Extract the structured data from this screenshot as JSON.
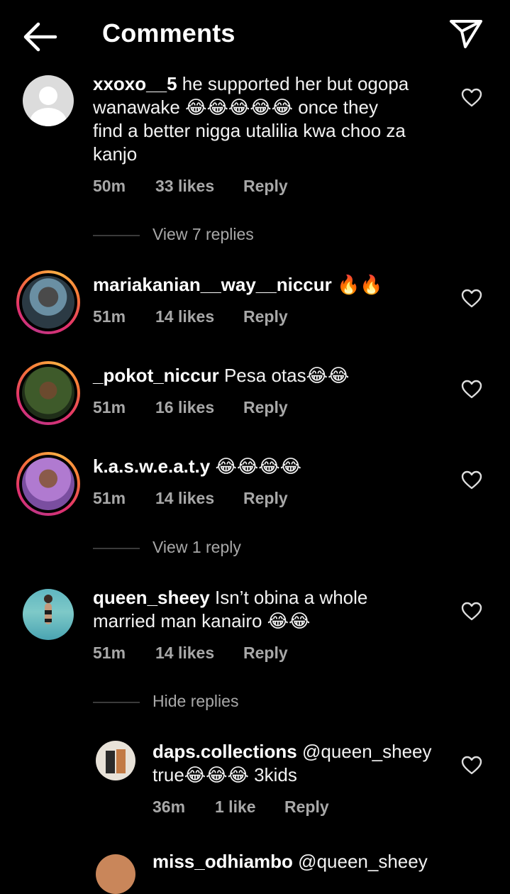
{
  "header": {
    "title": "Comments",
    "back_icon": "arrow-left-icon",
    "share_icon": "paper-plane-icon"
  },
  "comments": [
    {
      "username": "xxoxo__5",
      "text_a": "he supported her but ogopa",
      "text_b": "wanawake 😂😂😂😂😂 once they",
      "text_c": "find a better nigga utalilia kwa choo za",
      "text_d": "kanjo",
      "time": "50m",
      "likes": "33 likes",
      "reply": "Reply",
      "thread": "View 7 replies"
    },
    {
      "username": "mariakanian__way__niccur",
      "text": "🔥🔥",
      "time": "51m",
      "likes": "14 likes",
      "reply": "Reply"
    },
    {
      "username": "_pokot_niccur",
      "text": "Pesa otas😂😂",
      "time": "51m",
      "likes": "16 likes",
      "reply": "Reply"
    },
    {
      "username": "k.a.s.w.e.a.t.y",
      "text": "😂😂😂😂",
      "time": "51m",
      "likes": "14 likes",
      "reply": "Reply",
      "thread": "View 1 reply"
    },
    {
      "username": "queen_sheey",
      "text_a": "Isn’t obina a whole",
      "text_b": "married man kanairo 😂😂",
      "time": "51m",
      "likes": "14 likes",
      "reply": "Reply",
      "thread": "Hide replies"
    }
  ],
  "replies": [
    {
      "username": "daps.collections",
      "text_a": "@queen_sheey",
      "text_b": "true😂😂😂 3kids",
      "time": "36m",
      "likes": "1 like",
      "reply": "Reply"
    },
    {
      "username": "miss_odhiambo",
      "text_a": "@queen_sheey"
    }
  ],
  "colors": {
    "background": "#000000",
    "text": "#ffffff",
    "secondary": "#a8a8a8",
    "story_ring": "#e1306c"
  }
}
